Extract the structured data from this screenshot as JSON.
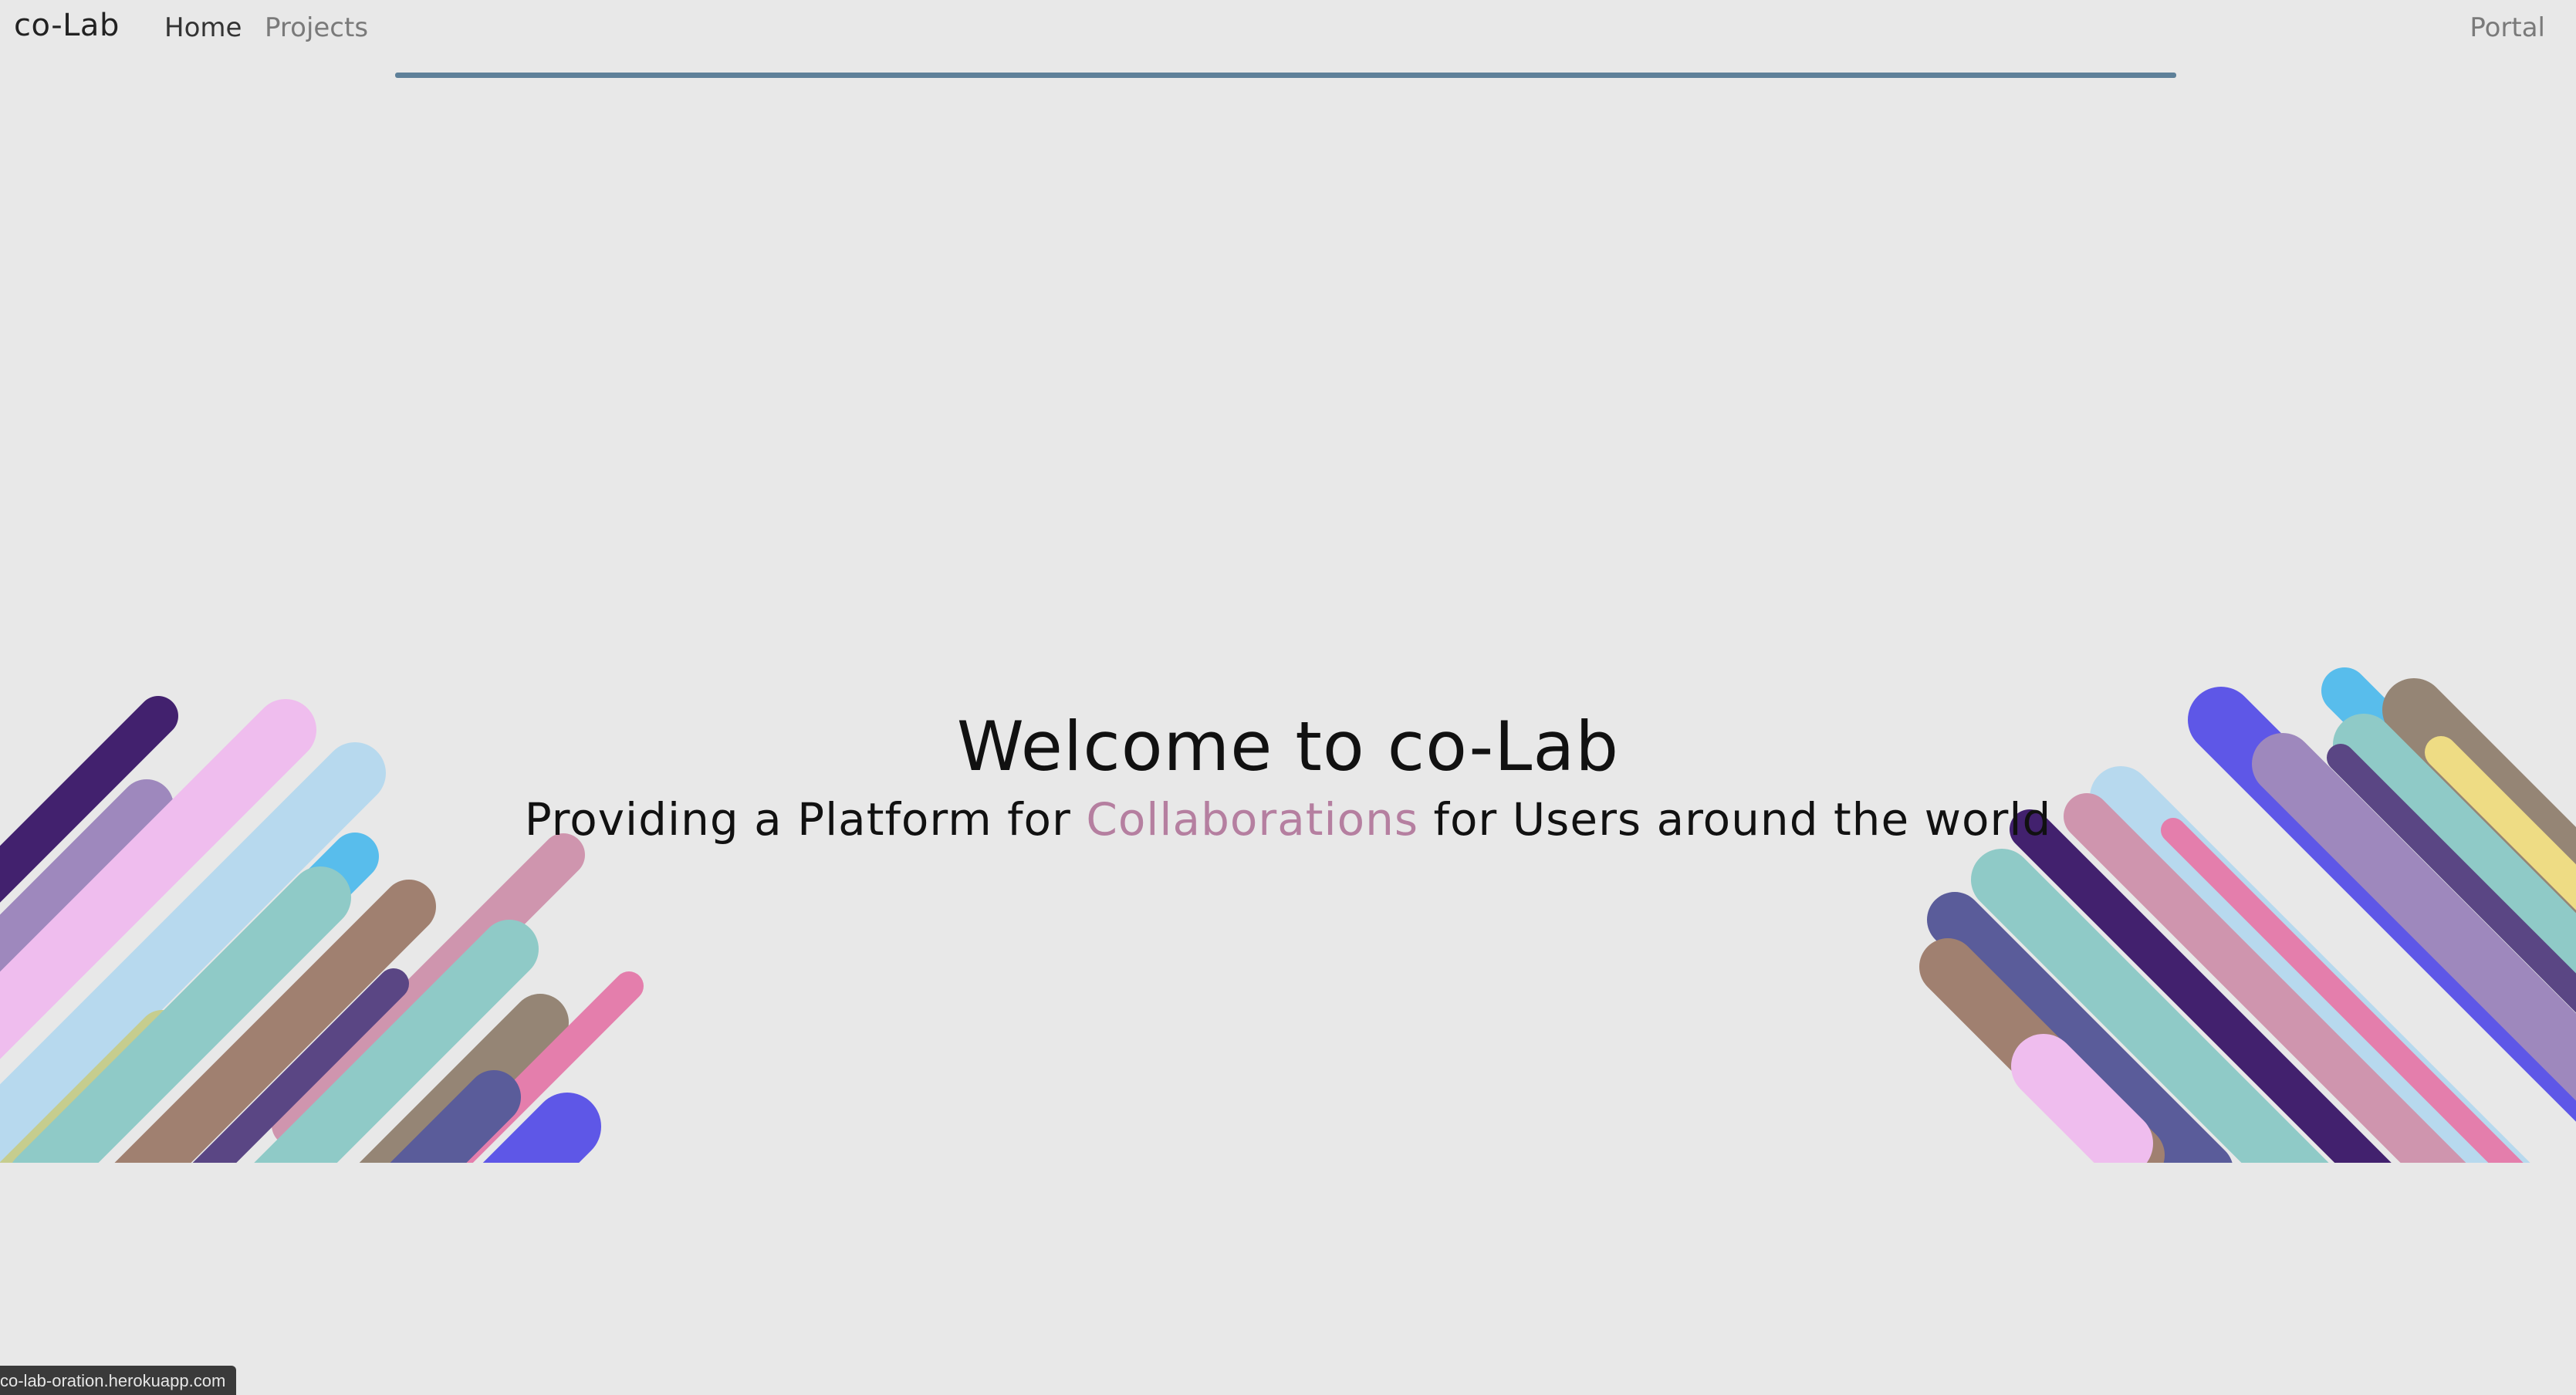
{
  "nav": {
    "brand": "co-Lab",
    "links": [
      {
        "label": "Home"
      },
      {
        "label": "Projects"
      }
    ],
    "portal": "Portal",
    "progress_color": "#5e8099"
  },
  "hero": {
    "title": "Welcome to co-Lab",
    "subtitle_prefix": "Providing a Platform for ",
    "subtitle_accent": "Collaborations",
    "subtitle_suffix": " for Users around the world",
    "accent_color": "#b57fa0"
  },
  "decorations": {
    "palette": [
      "#42216e",
      "#9e88bd",
      "#efbdee",
      "#b7d9ee",
      "#58bdec",
      "#c6cd8e",
      "#8fcac7",
      "#a08070",
      "#cf95ae",
      "#5a4684",
      "#958575",
      "#e47eac",
      "#5a5c9a",
      "#5e57e7",
      "#eedc84"
    ]
  },
  "status_bar": {
    "url": "co-lab-oration.herokuapp.com"
  }
}
